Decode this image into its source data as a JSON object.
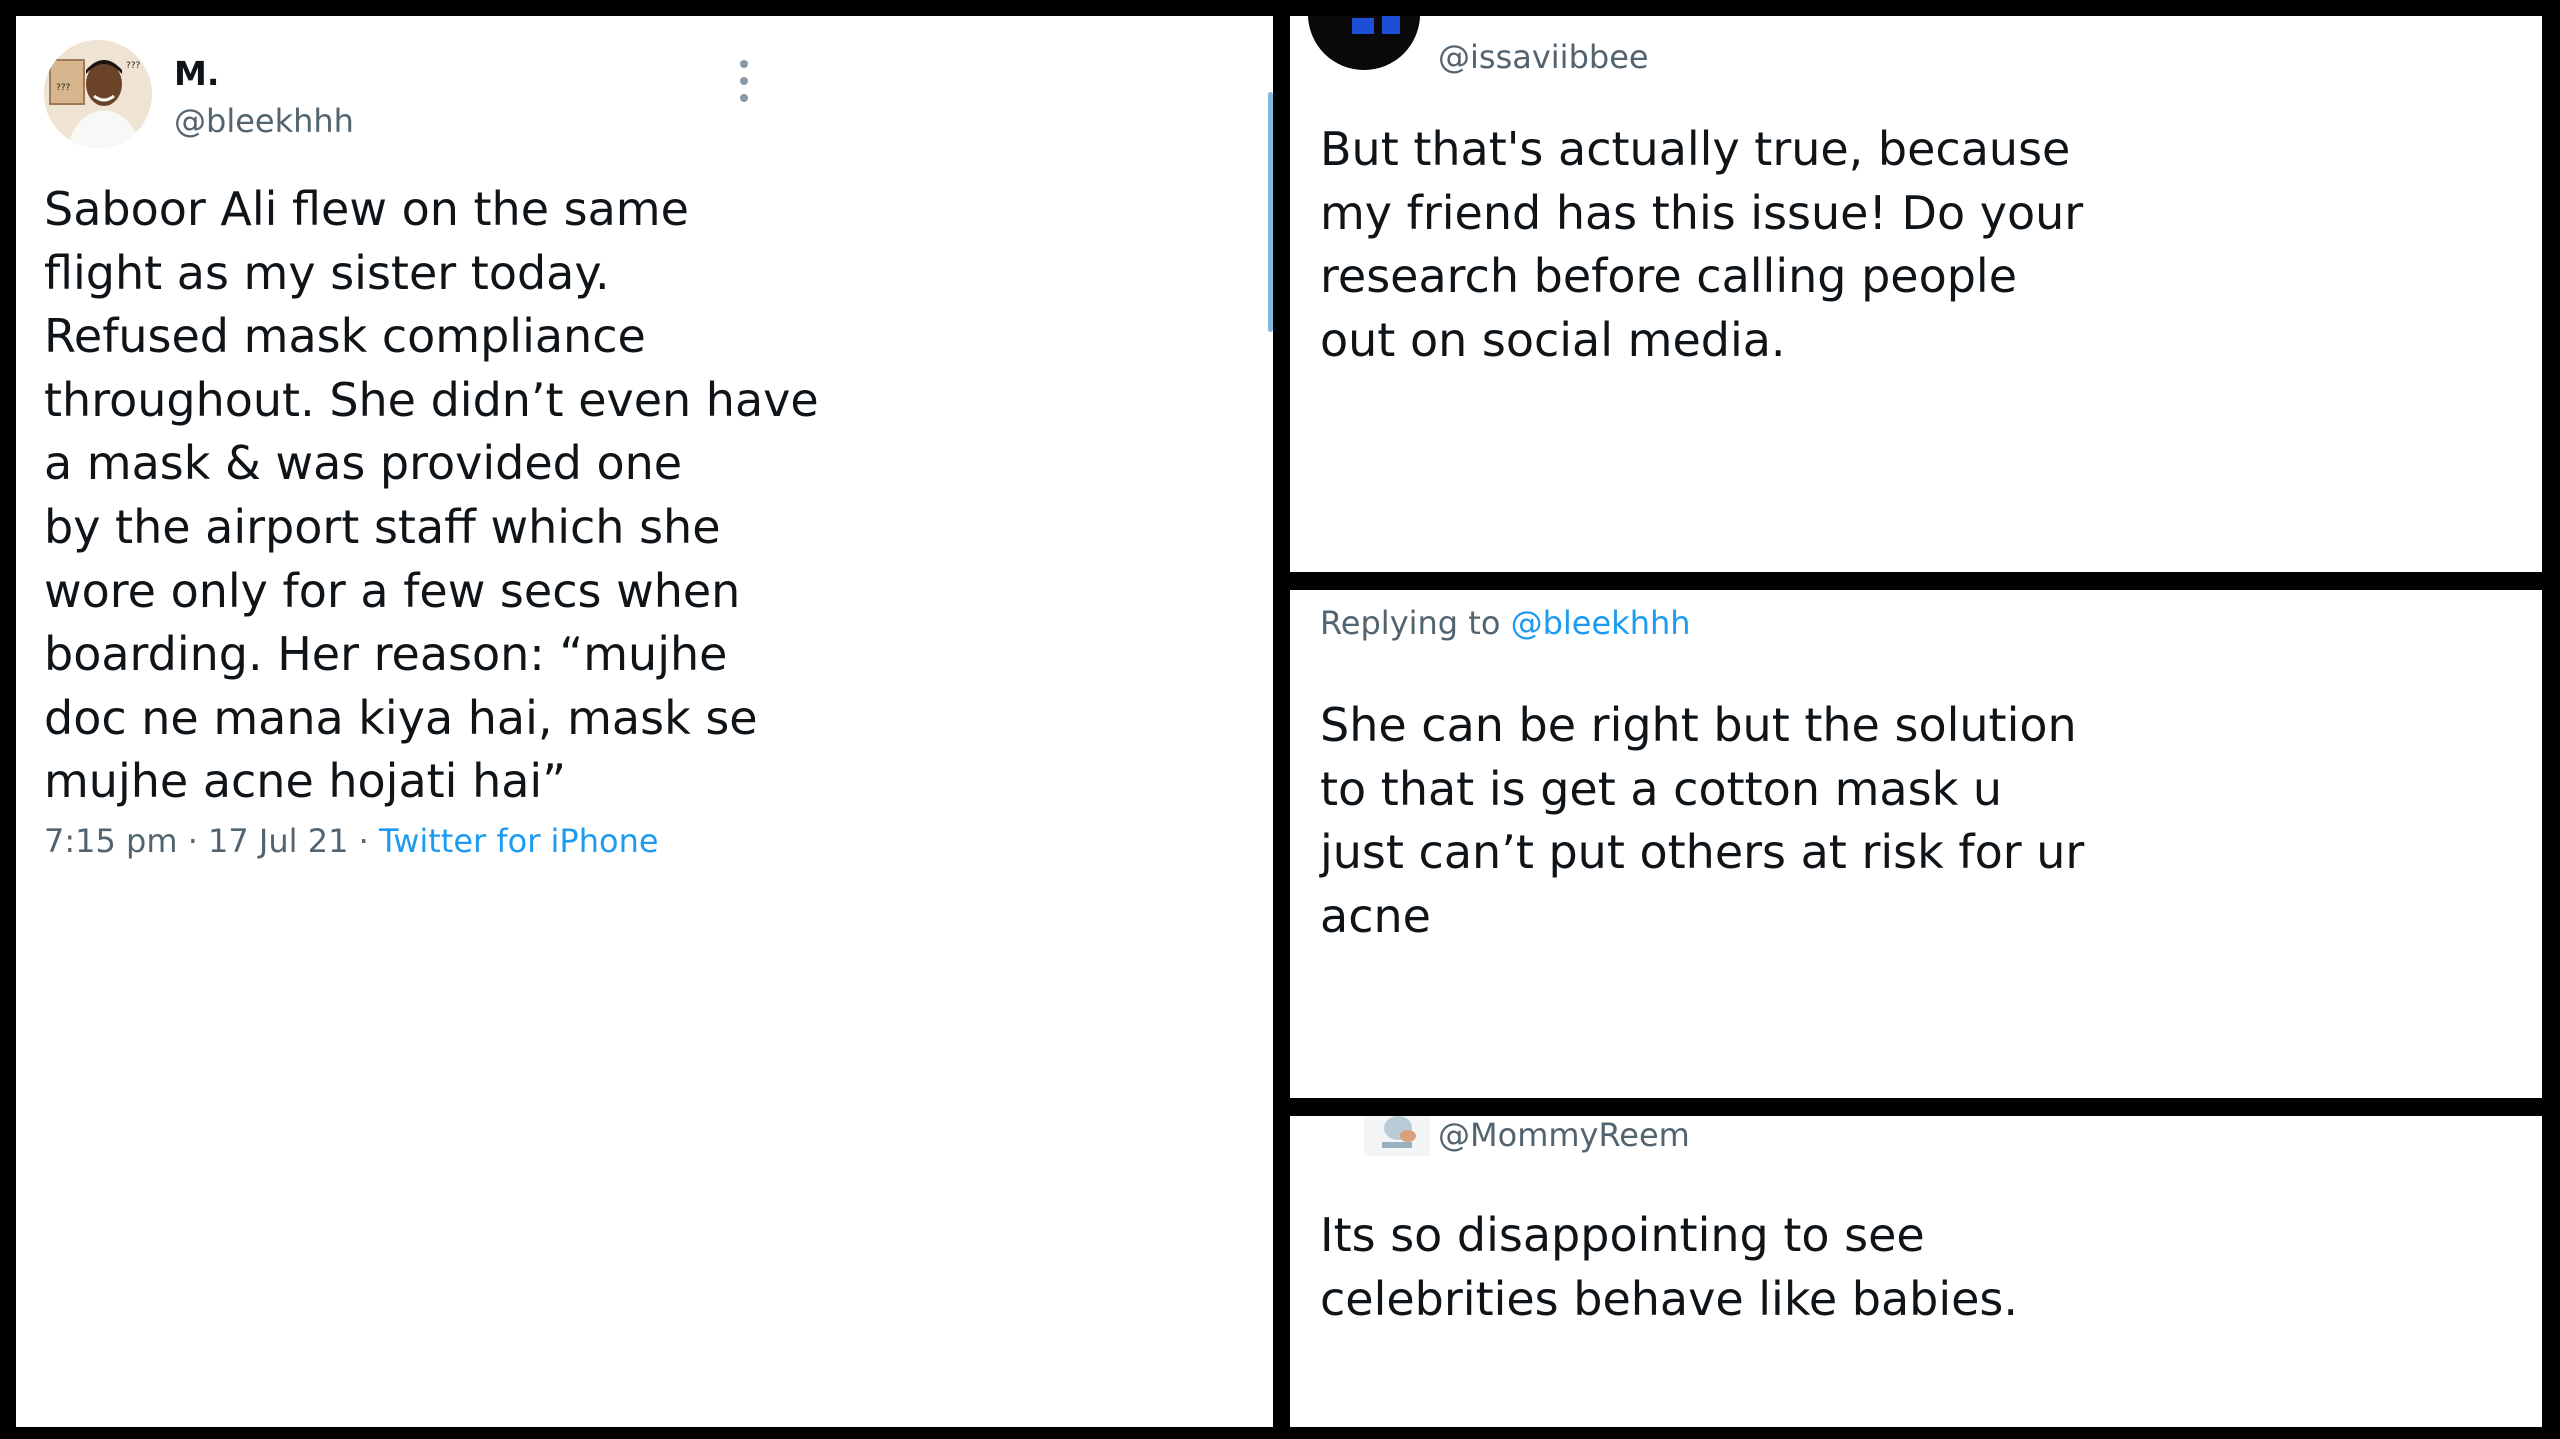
{
  "main_tweet": {
    "display_name": "M.",
    "handle": "@bleekhhh",
    "text": "Saboor Ali flew on the same\nflight as my sister today.\nRefused mask compliance\nthroughout. She didn’t even have\na mask & was provided one\nby the airport staff which she\nwore only for a few secs when\nboarding. Her reason: “mujhe\ndoc ne mana kiya hai, mask se\nmujhe acne hojati hai”",
    "time": "7:15 pm",
    "separator": "·",
    "date": "17 Jul 21",
    "source": "Twitter for iPhone",
    "avatar_marks": [
      "???",
      "???"
    ]
  },
  "replies": [
    {
      "handle": "@issaviibbee",
      "text": "But that's actually true, because\nmy friend has this issue! Do your\nresearch before calling people\nout on social media."
    },
    {
      "replying_prefix": "Replying to",
      "replying_to": "@bleekhhh",
      "text": "She can be right but the solution\nto that is get a cotton mask u\njust can’t put others at risk for ur\nacne"
    },
    {
      "handle": "@MommyReem",
      "text": "Its so disappointing to see\ncelebrities behave like babies."
    }
  ],
  "colors": {
    "text": "#0f1419",
    "secondary": "#536471",
    "link": "#1d9bf0",
    "border": "#000000"
  }
}
